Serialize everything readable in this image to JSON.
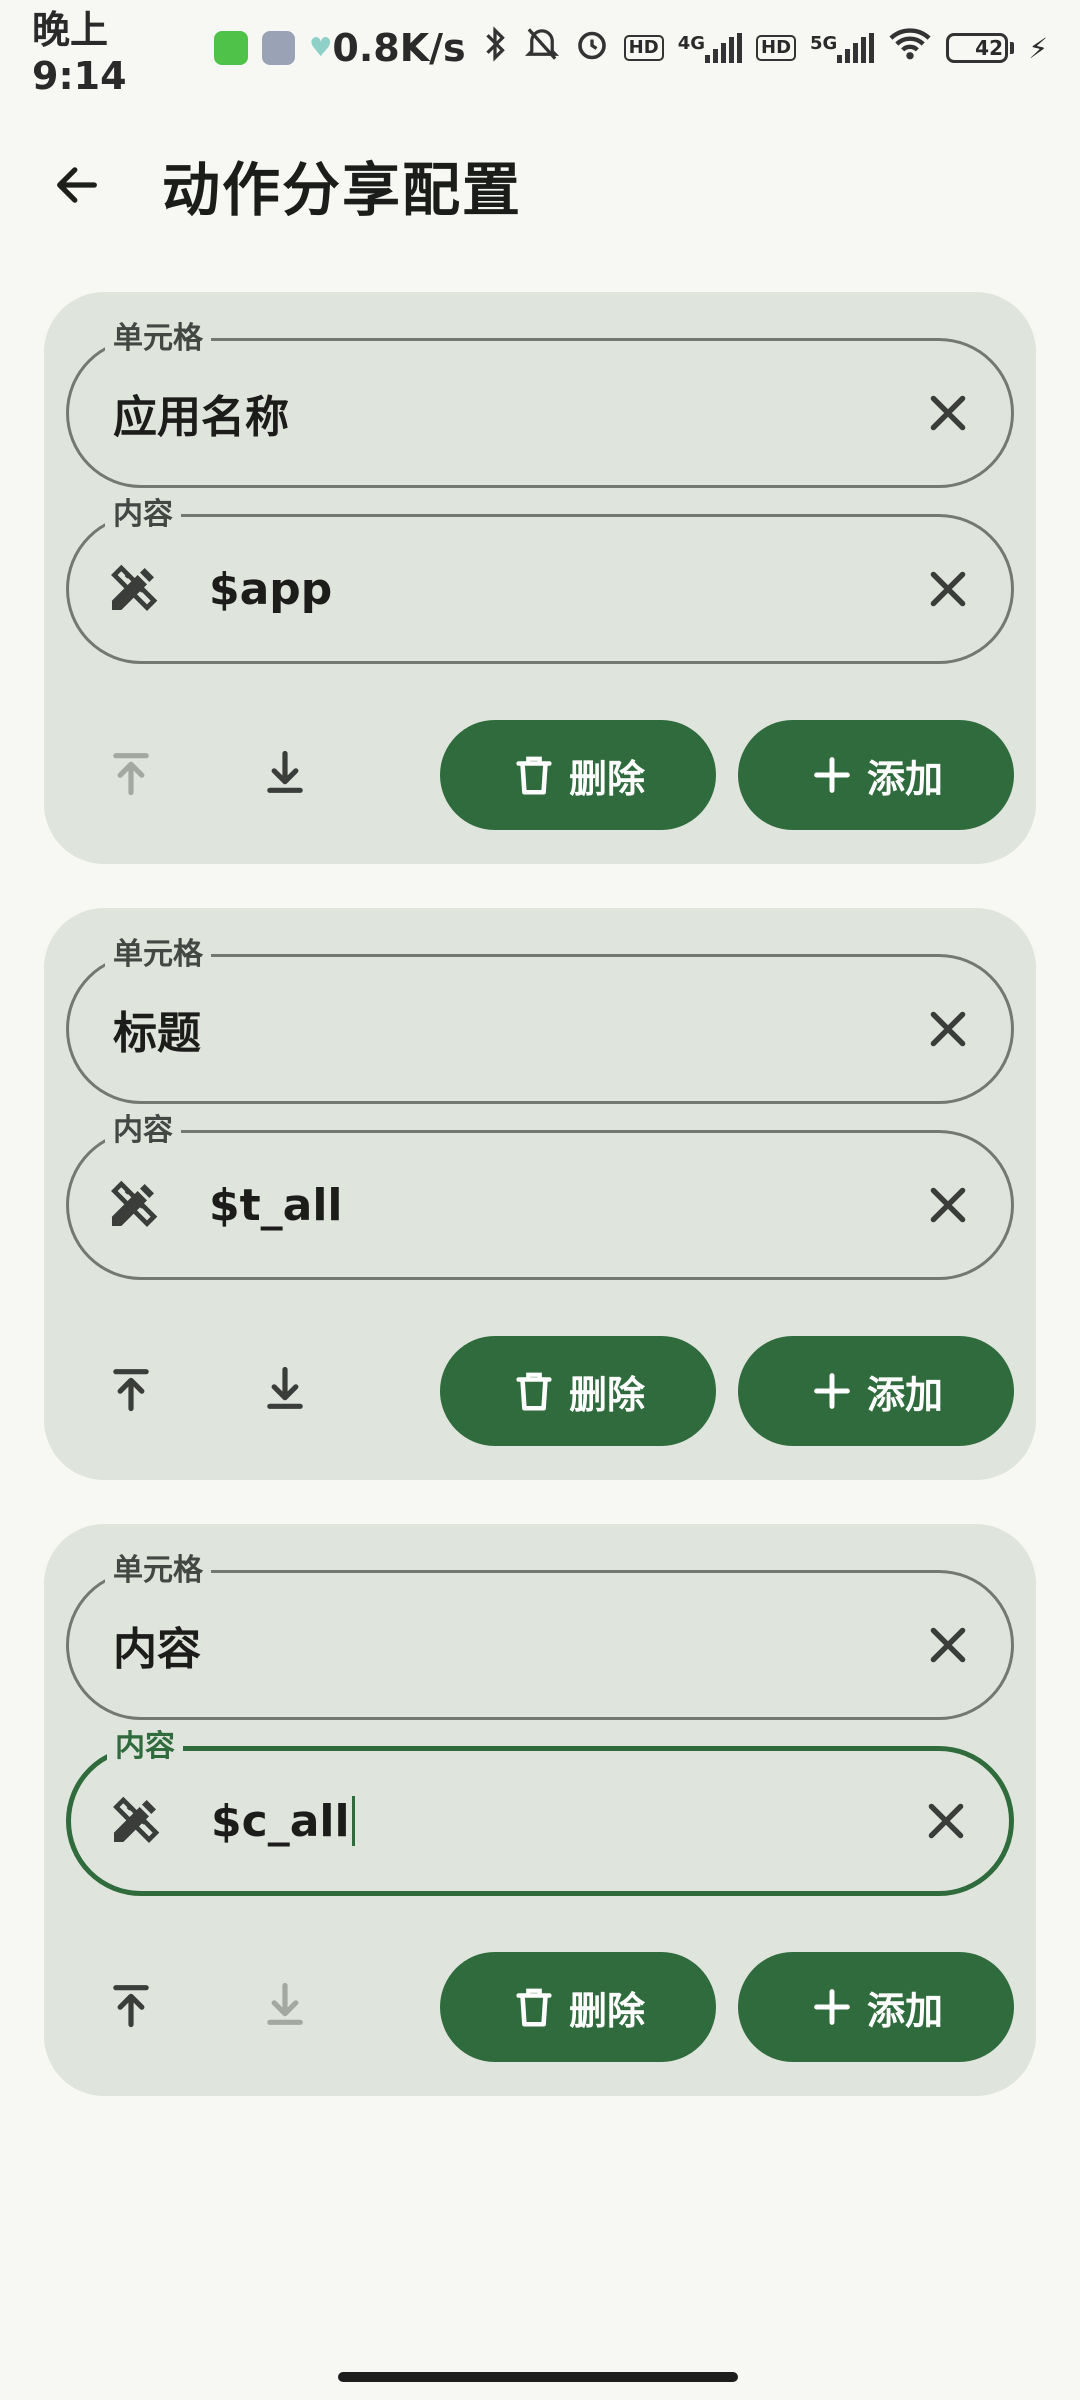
{
  "status_bar": {
    "time": "晚上9:14",
    "network_speed": "0.8K/s",
    "net_4g": "4G",
    "net_5g": "5G",
    "hd1": "HD",
    "hd2": "HD",
    "battery": "42"
  },
  "app_bar": {
    "title": "动作分享配置"
  },
  "cards": [
    {
      "cell_label": "单元格",
      "cell_value": "应用名称",
      "content_label": "内容",
      "content_value": "$app",
      "move_up_enabled": false,
      "move_down_enabled": true,
      "delete_label": "删除",
      "add_label": "添加"
    },
    {
      "cell_label": "单元格",
      "cell_value": "标题",
      "content_label": "内容",
      "content_value": "$t_all",
      "move_up_enabled": true,
      "move_down_enabled": true,
      "delete_label": "删除",
      "add_label": "添加"
    },
    {
      "cell_label": "单元格",
      "cell_value": "内容",
      "content_label": "内容",
      "content_value": "$c_all",
      "move_up_enabled": true,
      "move_down_enabled": false,
      "delete_label": "删除",
      "add_label": "添加"
    }
  ],
  "colors": {
    "accent": "#2f6b3c",
    "card_bg": "#dfe4dc",
    "page_bg": "#f7f8f3",
    "disabled_icon": "#a3a8a1"
  },
  "icons": {
    "back": "arrow-left-icon",
    "clear": "close-icon",
    "content_leading": "pencil-ruler-icon",
    "move_up": "move-to-top-icon",
    "move_down": "move-to-bottom-icon",
    "delete": "trash-icon",
    "add": "plus-icon"
  }
}
